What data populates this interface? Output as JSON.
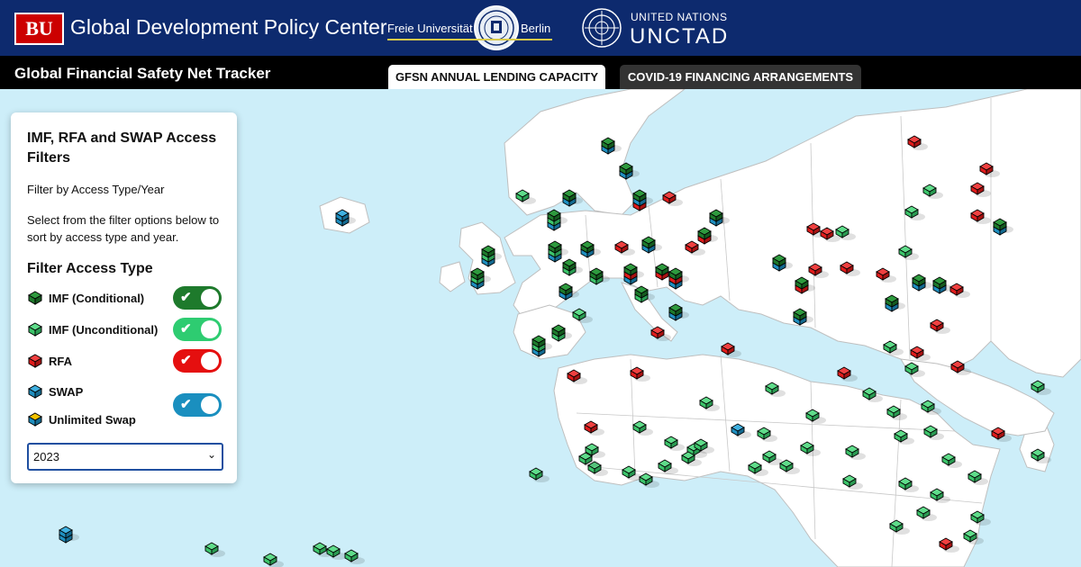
{
  "header": {
    "bu_logo": "BU",
    "center_title": "Global Development Policy Center",
    "fu_left": "Freie Universität",
    "fu_right": "Berlin",
    "un_line1": "UNITED NATIONS",
    "un_line2": "UNCTAD"
  },
  "subbar": {
    "tracker_title": "Global Financial Safety Net Tracker",
    "tabs": [
      {
        "label": "GFSN ANNUAL LENDING CAPACITY",
        "active": true
      },
      {
        "label": "COVID-19 FINANCING ARRANGEMENTS",
        "active": false
      }
    ]
  },
  "panel": {
    "title": "IMF, RFA and SWAP Access Filters",
    "filter_by": "Filter by Access Type/Year",
    "description": "Select from the filter options below to sort by access type and year.",
    "filter_heading": "Filter Access Type",
    "filters": [
      {
        "label": "IMF (Conditional)",
        "icon": "imf-conditional-cube-icon",
        "color": "#1e7a2c",
        "toggle": true,
        "toggle_color": "#1e7a2c"
      },
      {
        "label": "IMF (Unconditional)",
        "icon": "imf-unconditional-cube-icon",
        "color": "#3cc46a",
        "toggle": true,
        "toggle_color": "#2ecc71"
      },
      {
        "label": "RFA",
        "icon": "rfa-cube-icon",
        "color": "#e01b1b",
        "toggle": true,
        "toggle_color": "#e50f0f"
      },
      {
        "label": "SWAP",
        "icon": "swap-cube-icon",
        "color": "#1f8fc0",
        "toggle": false
      },
      {
        "label": "Unlimited Swap",
        "icon": "unlimited-swap-cube-icon",
        "color": "#f2c200",
        "toggle": true,
        "toggle_color": "#1a8fbf"
      }
    ],
    "year_select": {
      "value": "2023"
    }
  },
  "colors": {
    "header_bg": "#0d2a6e",
    "ocean": "#cdeef9",
    "land": "#ffffff",
    "imf_conditional": "#1e7a2c",
    "imf_unconditional": "#3cc46a",
    "rfa": "#e01b1b",
    "swap": "#1f8fc0",
    "unlimited_swap": "#f2c200"
  }
}
